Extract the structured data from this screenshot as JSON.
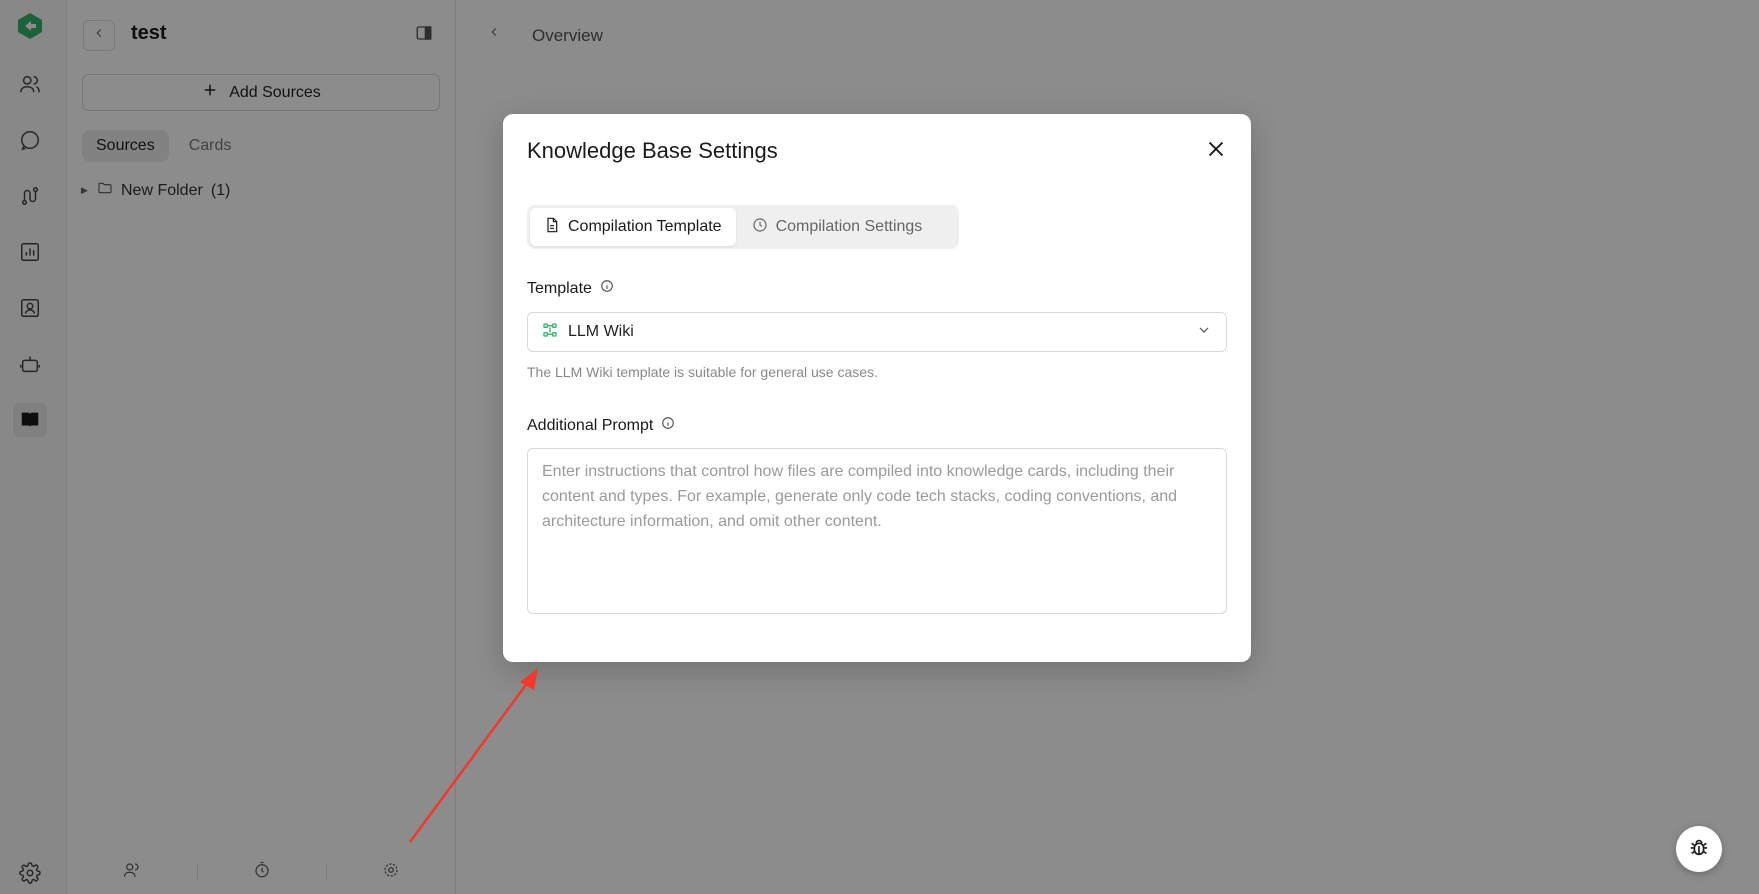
{
  "sidebar": {
    "panel_title": "test",
    "add_sources_label": "Add Sources",
    "tabs": [
      {
        "label": "Sources",
        "active": true
      },
      {
        "label": "Cards",
        "active": false
      }
    ],
    "folder": {
      "name": "New Folder",
      "count": "(1)"
    }
  },
  "main": {
    "breadcrumb": "Overview"
  },
  "modal": {
    "title": "Knowledge Base Settings",
    "tabs": [
      {
        "label": "Compilation Template",
        "active": true
      },
      {
        "label": "Compilation Settings",
        "active": false
      }
    ],
    "template_label": "Template",
    "template_value": "LLM Wiki",
    "template_hint": "The LLM Wiki template is suitable for general use cases.",
    "prompt_label": "Additional Prompt",
    "prompt_placeholder": "Enter instructions that control how files are compiled into knowledge cards, including their content and types. For example, generate only code tech stacks, coding conventions, and architecture information, and omit other content."
  },
  "icons": {
    "rail": [
      "logo-icon",
      "users-icon",
      "chat-icon",
      "workflow-icon",
      "chart-icon",
      "contact-card-icon",
      "robot-icon",
      "book-icon",
      "settings-icon"
    ],
    "panel_bottom": [
      "team-icon",
      "timer-icon",
      "gear-icon"
    ]
  },
  "colors": {
    "accent_green": "#2fb36b",
    "annotation_red": "#f0392b",
    "overlay": "rgba(0,0,0,0.45)"
  }
}
